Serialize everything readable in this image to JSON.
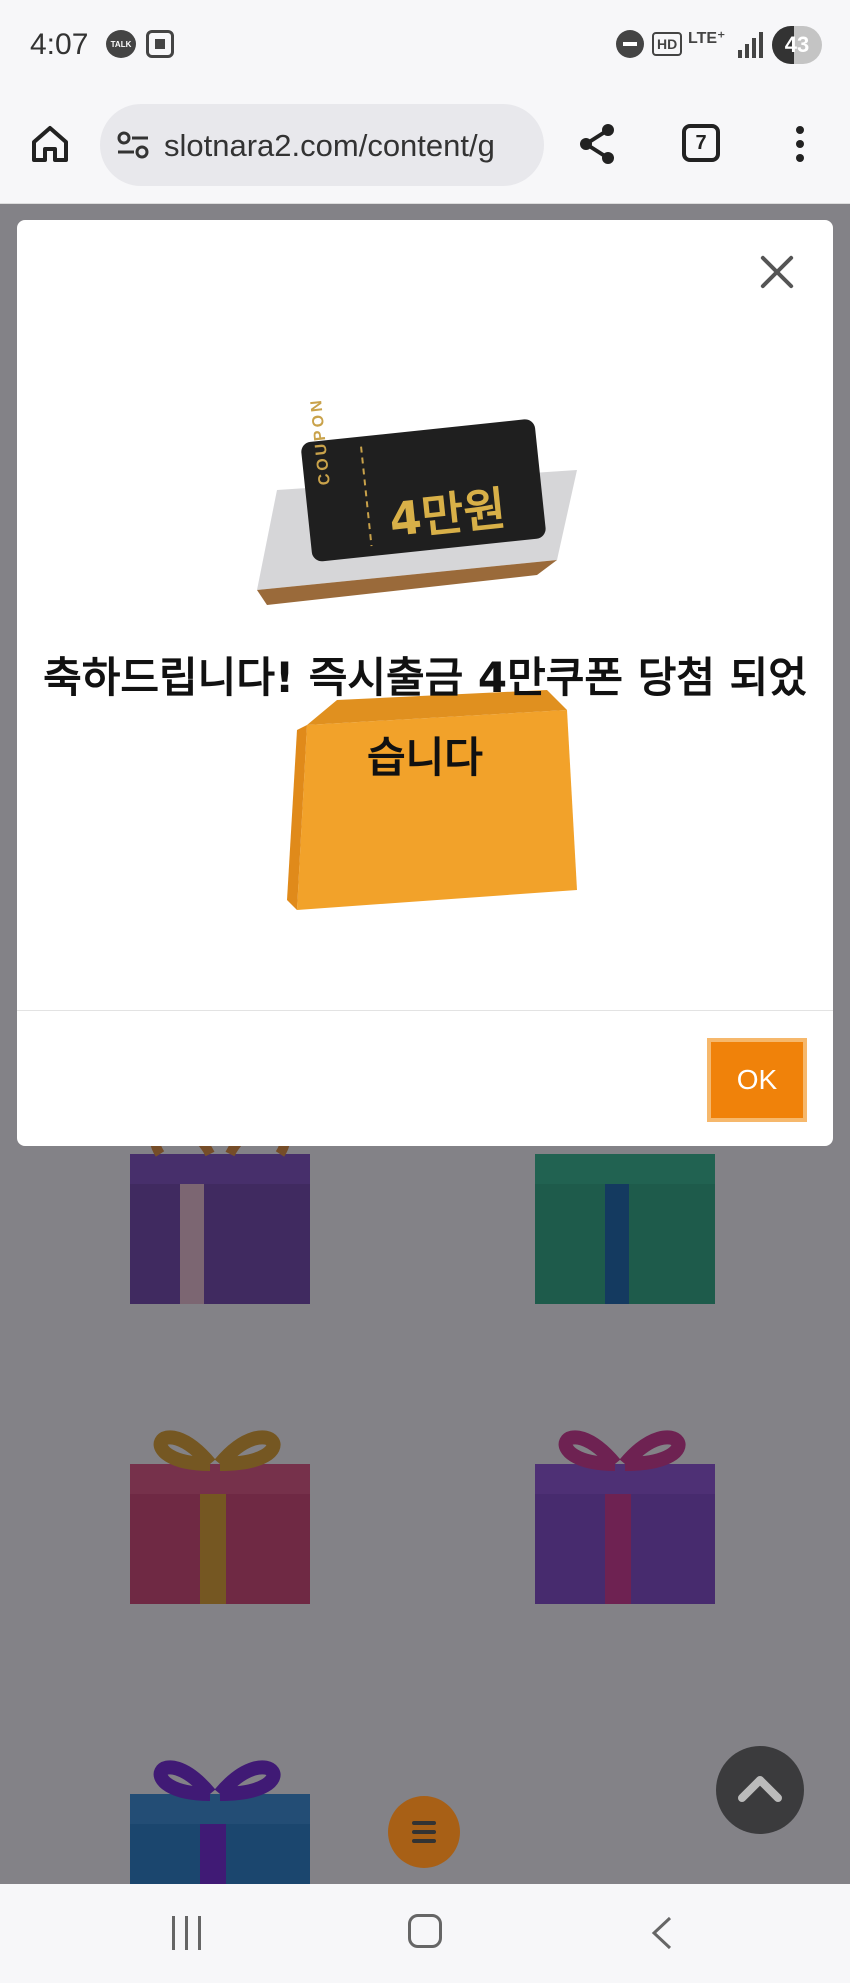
{
  "status_bar": {
    "time": "4:07",
    "talk_icon_label": "TALK",
    "hd_label": "HD",
    "network_label": "LTE⁺",
    "battery_level": "43"
  },
  "browser": {
    "url": "slotnara2.com/content/g",
    "tab_count": "7"
  },
  "modal": {
    "coupon_label": "COUPON",
    "coupon_amount": "4만원",
    "message": "축하드립니다! 즉시출금 4만쿠폰 당첨 되었습니다",
    "ok_label": "OK"
  },
  "colors": {
    "accent": "#f0820a",
    "overlay": "#1e1c24"
  }
}
